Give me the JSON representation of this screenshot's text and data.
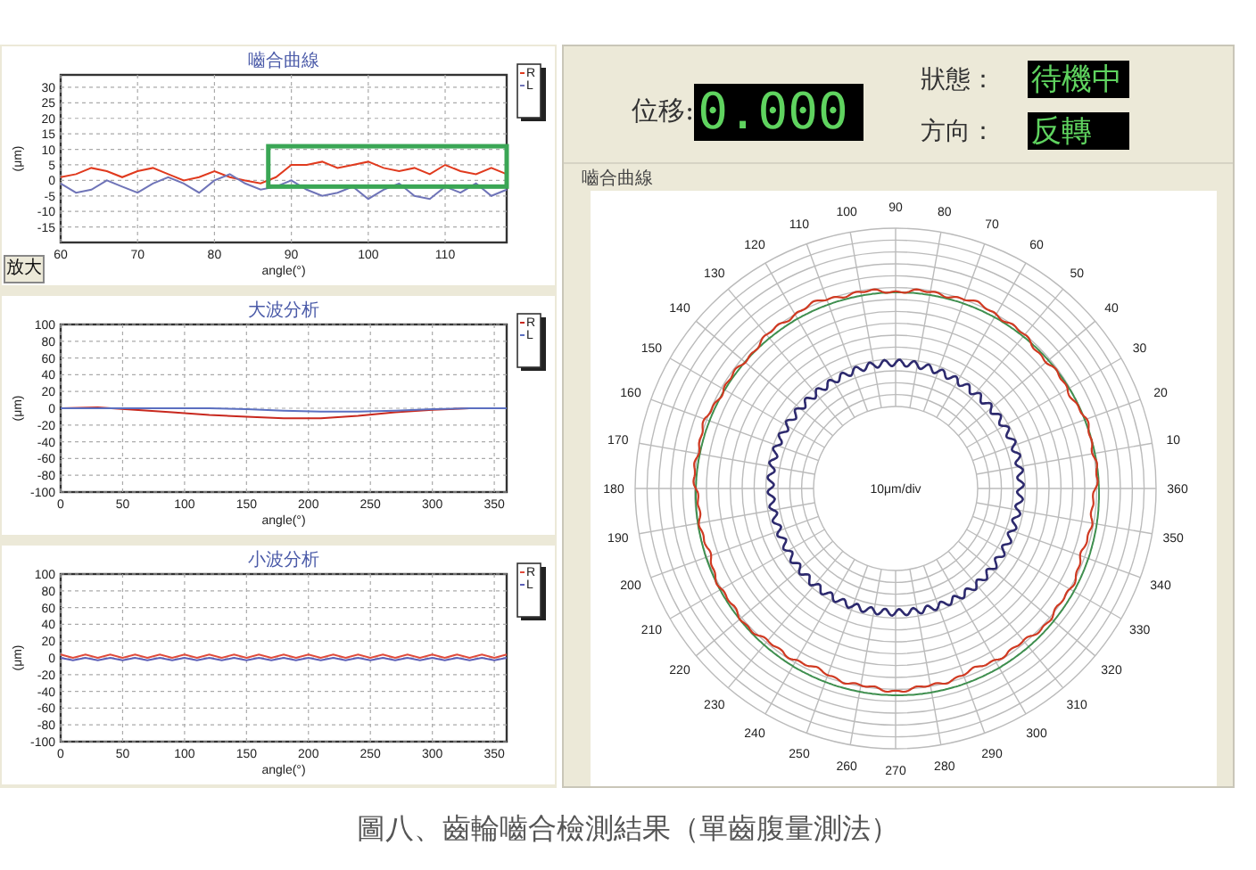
{
  "left_charts": [
    {
      "button": "放大",
      "highlight_frame": true,
      "chart_data": {
        "type": "line",
        "title": "嚙合曲線",
        "grid": true,
        "legend": "right",
        "xlabel": "angle(°)",
        "ylabel": "(μm)",
        "x": [
          60,
          62,
          64,
          66,
          68,
          70,
          72,
          74,
          76,
          78,
          80,
          82,
          84,
          86,
          88,
          90,
          92,
          94,
          96,
          98,
          100,
          102,
          104,
          106,
          108,
          110,
          112,
          114,
          116,
          118
        ],
        "series": [
          {
            "name": "R",
            "color": "#e03a1e",
            "values": [
              1,
              2,
              4,
              3,
              1,
              3,
              4,
              2,
              0,
              1,
              3,
              1,
              0,
              -1,
              1,
              5,
              5,
              6,
              4,
              5,
              6,
              4,
              3,
              4,
              2,
              5,
              3,
              2,
              4,
              2
            ]
          },
          {
            "name": "L",
            "color": "#6f74b8",
            "values": [
              -1,
              -4,
              -3,
              0,
              -2,
              -4,
              -1,
              1,
              -1,
              -4,
              0,
              2,
              -1,
              -3,
              -2,
              0,
              -3,
              -5,
              -4,
              -2,
              -6,
              -3,
              -1,
              -5,
              -6,
              -2,
              -4,
              -1,
              -5,
              -3
            ]
          }
        ],
        "xlim": [
          60,
          118
        ],
        "ylim": [
          -20,
          34
        ],
        "xticks": [
          60,
          70,
          80,
          90,
          100,
          110
        ],
        "yticks": [
          -15,
          -10,
          -5,
          0,
          5,
          10,
          15,
          20,
          25,
          30
        ]
      }
    },
    {
      "chart_data": {
        "type": "line",
        "title": "大波分析",
        "grid": true,
        "legend": "right",
        "xlabel": "angle(°)",
        "ylabel": "(μm)",
        "x": [
          0,
          30,
          60,
          90,
          120,
          150,
          180,
          210,
          240,
          270,
          300,
          330,
          360
        ],
        "series": [
          {
            "name": "R",
            "color": "#c8281e",
            "values": [
              0,
              1,
              -2,
              -5,
              -8,
              -10,
              -12,
              -12,
              -9,
              -5,
              -2,
              0,
              0
            ]
          },
          {
            "name": "L",
            "color": "#5b6fc0",
            "values": [
              0,
              0,
              0,
              0,
              0,
              -1,
              -3,
              -4,
              -4,
              -3,
              -1,
              0,
              0
            ]
          }
        ],
        "xlim": [
          0,
          360
        ],
        "ylim": [
          -100,
          100
        ],
        "xticks": [
          0,
          50,
          100,
          150,
          200,
          250,
          300,
          350
        ],
        "yticks": [
          -100,
          -80,
          -60,
          -40,
          -20,
          0,
          20,
          40,
          60,
          80,
          100
        ]
      }
    },
    {
      "chart_data": {
        "type": "line",
        "title": "小波分析",
        "grid": true,
        "legend": "right",
        "xlabel": "angle(°)",
        "ylabel": "(μm)",
        "x": [
          0,
          10,
          20,
          30,
          40,
          50,
          60,
          70,
          80,
          90,
          100,
          110,
          120,
          130,
          140,
          150,
          160,
          170,
          180,
          190,
          200,
          210,
          220,
          230,
          240,
          250,
          260,
          270,
          280,
          290,
          300,
          310,
          320,
          330,
          340,
          350,
          360
        ],
        "series": [
          {
            "name": "R",
            "color": "#e04a3a",
            "values": [
              4,
              0,
              4,
              0,
              4,
              0,
              4,
              0,
              4,
              0,
              4,
              0,
              4,
              0,
              4,
              0,
              4,
              0,
              4,
              0,
              4,
              0,
              4,
              0,
              4,
              0,
              4,
              0,
              4,
              0,
              4,
              0,
              4,
              0,
              4,
              0,
              4
            ]
          },
          {
            "name": "L",
            "color": "#5b5fb8",
            "values": [
              0,
              -3,
              0,
              -3,
              0,
              -3,
              0,
              -3,
              0,
              -3,
              0,
              -3,
              0,
              -3,
              0,
              -3,
              0,
              -3,
              0,
              -3,
              0,
              -3,
              0,
              -3,
              0,
              -3,
              0,
              -3,
              0,
              -3,
              0,
              -3,
              0,
              -3,
              0,
              -3,
              0
            ]
          }
        ],
        "xlim": [
          0,
          360
        ],
        "ylim": [
          -100,
          100
        ],
        "xticks": [
          0,
          50,
          100,
          150,
          200,
          250,
          300,
          350
        ],
        "yticks": [
          -100,
          -80,
          -60,
          -40,
          -20,
          0,
          20,
          40,
          60,
          80,
          100
        ]
      }
    }
  ],
  "readouts": {
    "displacement": {
      "label": "位移:",
      "value": "0.000"
    },
    "status": {
      "label": "狀態：",
      "value": "待機中"
    },
    "direction": {
      "label": "方向：",
      "value": "反轉"
    }
  },
  "polar_plot": {
    "group_label": "嚙合曲線",
    "scale_label": "10μm/div",
    "angle_labels": [
      "90",
      "100",
      "80",
      "110",
      "70",
      "120",
      "60",
      "130",
      "50",
      "140",
      "40",
      "150",
      "30",
      "160",
      "20",
      "170",
      "10",
      "180",
      "360",
      "190",
      "350",
      "200",
      "340",
      "210",
      "330",
      "220",
      "320",
      "230",
      "310",
      "240",
      "300",
      "250",
      "290",
      "260",
      "280",
      "270"
    ]
  },
  "caption": "圖八、齒輪嚙合檢測結果（單齒腹量測法）"
}
